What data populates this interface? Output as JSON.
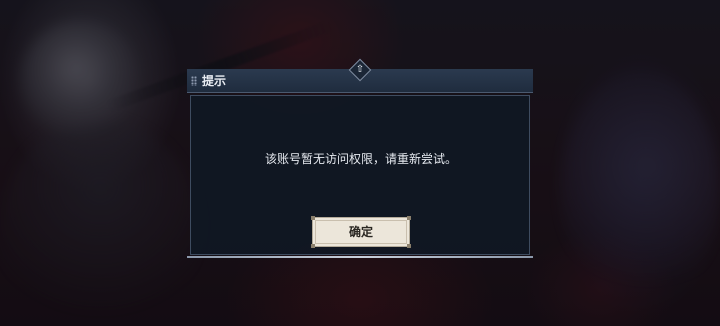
{
  "dialog": {
    "title": "提示",
    "message": "该账号暂无访问权限，请重新尝试。",
    "confirm_label": "确定",
    "emblem_glyph": "⇧"
  },
  "colors": {
    "header_bg": "#2b3a4f",
    "body_bg": "#101824",
    "button_bg": "#ece6da",
    "text": "#e6eaf0"
  }
}
